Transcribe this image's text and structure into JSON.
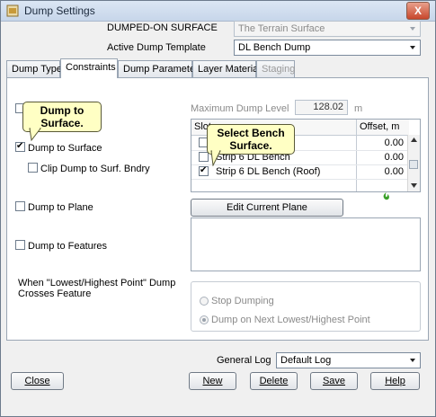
{
  "window": {
    "title": "Dump Settings",
    "close_glyph": "X"
  },
  "top": {
    "dumped_on_label": "DUMPED-ON SURFACE",
    "dumped_on_value": "The Terrain Surface",
    "template_label": "Active Dump Template",
    "template_value": "DL Bench Dump"
  },
  "tabs": [
    {
      "label": "Dump Type"
    },
    {
      "label": "Constraints"
    },
    {
      "label": "Dump Parameters"
    },
    {
      "label": "Layer Material"
    },
    {
      "label": "Staging"
    }
  ],
  "constraints": {
    "max_level_label": "Maximum  Dump Level",
    "max_level_value": "128.02",
    "max_level_unit": "m",
    "dump_to_surface": "Dump to Surface",
    "clip_dump": "Clip Dump to Surf. Bndry",
    "dump_to_plane": "Dump to Plane",
    "dump_to_features": "Dump to Features",
    "feature_note_line1": "When \"Lowest/Highest Point\" Dump",
    "feature_note_line2": "Crosses Feature",
    "edit_plane_button": "Edit Current Plane"
  },
  "surface_list": {
    "col_slot": "Slot",
    "col_offset": "Offset, m",
    "rows": [
      {
        "name": "",
        "offset": "0.00",
        "checked": false
      },
      {
        "name": "Strip 6 DL Bench",
        "offset": "0.00",
        "checked": false
      },
      {
        "name": "Strip 6 DL Bench (Roof)",
        "offset": "0.00",
        "checked": true
      }
    ]
  },
  "options": {
    "stop_dumping": "Stop Dumping",
    "dump_next": "Dump on Next Lowest/Highest Point"
  },
  "log": {
    "label": "General Log",
    "value": "Default Log"
  },
  "buttons": {
    "close": "Close",
    "new": "New",
    "delete": "Delete",
    "save": "Save",
    "help": "Help"
  },
  "callouts": {
    "dump_line1": "Dump to",
    "dump_line2": "Surface.",
    "bench_line1": "Select Bench",
    "bench_line2": "Surface."
  },
  "colors": {
    "callout_bg": "#ffffc4",
    "title_bar": "#c7d6ea",
    "green_icon": "#3aa02a"
  }
}
